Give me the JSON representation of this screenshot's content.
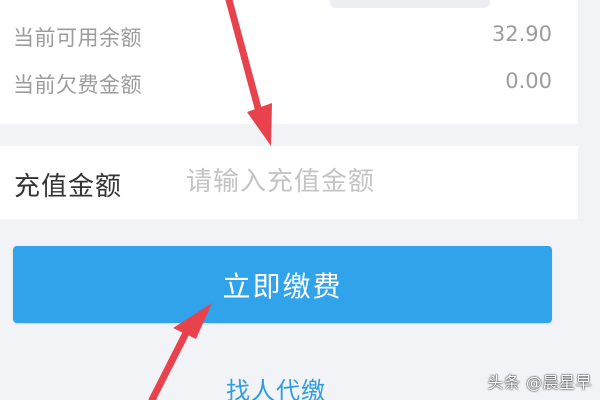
{
  "balance": {
    "available_label": "当前可用余额",
    "available_value": "32.90",
    "arrears_label": "当前欠费金额",
    "arrears_value": "0.00"
  },
  "recharge": {
    "label": "充值金额",
    "placeholder": "请输入充值金额",
    "value": ""
  },
  "actions": {
    "pay_label": "立即缴费",
    "proxy_pay_label": "找人代缴"
  },
  "annotations": {
    "arrow_color": "#e8424d"
  },
  "watermark": "头条 @晨星早",
  "colors": {
    "primary_button": "#30a3ea",
    "link": "#2e9de3",
    "background": "#f2f3f7"
  }
}
